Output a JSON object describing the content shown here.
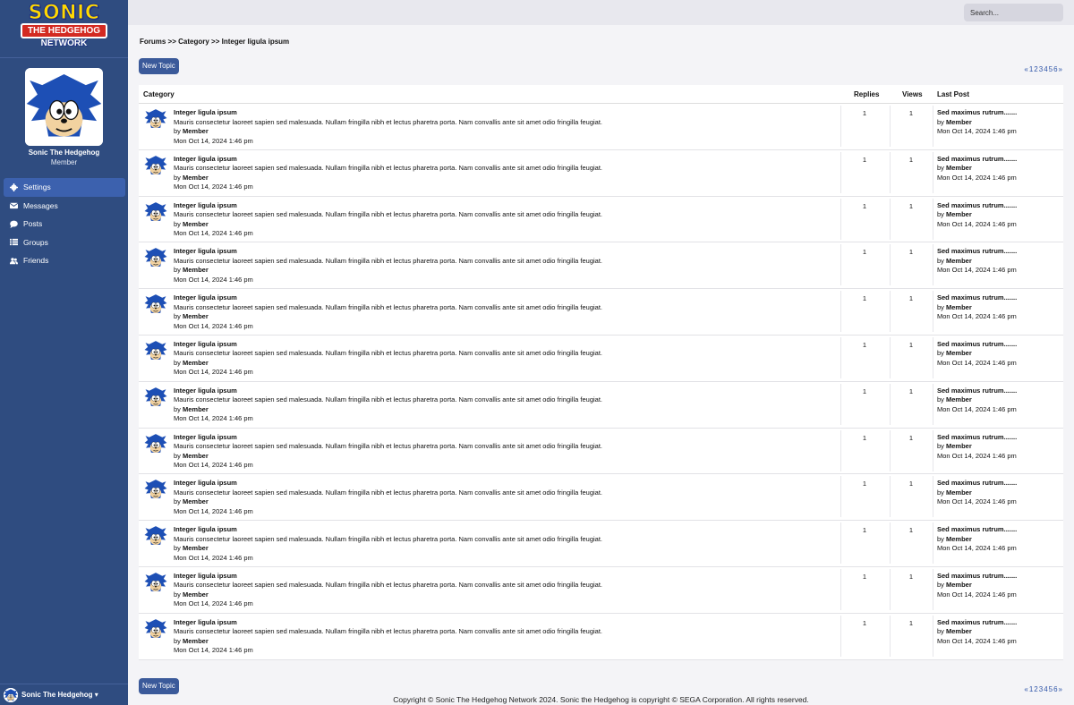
{
  "brand": {
    "line1": "SONIC",
    "line2": "THE HEDGEHOG",
    "line3": "NETWORK"
  },
  "profile": {
    "name": "Sonic The Hedgehog",
    "role": "Member"
  },
  "nav": [
    {
      "label": "Settings",
      "icon": "gear-icon"
    },
    {
      "label": "Messages",
      "icon": "envelope-icon"
    },
    {
      "label": "Posts",
      "icon": "speech-bubble-icon"
    },
    {
      "label": "Groups",
      "icon": "list-icon"
    },
    {
      "label": "Friends",
      "icon": "users-icon"
    }
  ],
  "user_menu": {
    "label": "Sonic The Hedgehog ▾"
  },
  "search": {
    "placeholder": "Search..."
  },
  "breadcrumb": "Forums >> Category >> Integer ligula ipsum",
  "buttons": {
    "new_topic": "New Topic"
  },
  "pagination": [
    "«",
    "1",
    "2",
    "3",
    "4",
    "5",
    "6",
    "»"
  ],
  "table": {
    "headers": {
      "category": "Category",
      "replies": "Replies",
      "views": "Views",
      "last_post": "Last Post"
    },
    "rows": [
      {
        "title": "Integer ligula ipsum",
        "desc": "Mauris consectetur laoreet sapien sed malesuada. Nullam fringilla nibh et lectus pharetra porta. Nam convallis ante sit amet odio fringilla feugiat.",
        "by": "by",
        "author": "Member",
        "date": "Mon Oct 14, 2024 1:46 pm",
        "replies": "1",
        "views": "1",
        "last_title": "Sed maximus rutrum.......",
        "last_by": "by",
        "last_author": "Member",
        "last_date": "Mon Oct 14, 2024 1:46 pm"
      },
      {
        "title": "Integer ligula ipsum",
        "desc": "Mauris consectetur laoreet sapien sed malesuada. Nullam fringilla nibh et lectus pharetra porta. Nam convallis ante sit amet odio fringilla feugiat.",
        "by": "by",
        "author": "Member",
        "date": "Mon Oct 14, 2024 1:46 pm",
        "replies": "1",
        "views": "1",
        "last_title": "Sed maximus rutrum.......",
        "last_by": "by",
        "last_author": "Member",
        "last_date": "Mon Oct 14, 2024 1:46 pm"
      },
      {
        "title": "Integer ligula ipsum",
        "desc": "Mauris consectetur laoreet sapien sed malesuada. Nullam fringilla nibh et lectus pharetra porta. Nam convallis ante sit amet odio fringilla feugiat.",
        "by": "by",
        "author": "Member",
        "date": "Mon Oct 14, 2024 1:46 pm",
        "replies": "1",
        "views": "1",
        "last_title": "Sed maximus rutrum.......",
        "last_by": "by",
        "last_author": "Member",
        "last_date": "Mon Oct 14, 2024 1:46 pm"
      },
      {
        "title": "Integer ligula ipsum",
        "desc": "Mauris consectetur laoreet sapien sed malesuada. Nullam fringilla nibh et lectus pharetra porta. Nam convallis ante sit amet odio fringilla feugiat.",
        "by": "by",
        "author": "Member",
        "date": "Mon Oct 14, 2024 1:46 pm",
        "replies": "1",
        "views": "1",
        "last_title": "Sed maximus rutrum.......",
        "last_by": "by",
        "last_author": "Member",
        "last_date": "Mon Oct 14, 2024 1:46 pm"
      },
      {
        "title": "Integer ligula ipsum",
        "desc": "Mauris consectetur laoreet sapien sed malesuada. Nullam fringilla nibh et lectus pharetra porta. Nam convallis ante sit amet odio fringilla feugiat.",
        "by": "by",
        "author": "Member",
        "date": "Mon Oct 14, 2024 1:46 pm",
        "replies": "1",
        "views": "1",
        "last_title": "Sed maximus rutrum.......",
        "last_by": "by",
        "last_author": "Member",
        "last_date": "Mon Oct 14, 2024 1:46 pm"
      },
      {
        "title": "Integer ligula ipsum",
        "desc": "Mauris consectetur laoreet sapien sed malesuada. Nullam fringilla nibh et lectus pharetra porta. Nam convallis ante sit amet odio fringilla feugiat.",
        "by": "by",
        "author": "Member",
        "date": "Mon Oct 14, 2024 1:46 pm",
        "replies": "1",
        "views": "1",
        "last_title": "Sed maximus rutrum.......",
        "last_by": "by",
        "last_author": "Member",
        "last_date": "Mon Oct 14, 2024 1:46 pm"
      },
      {
        "title": "Integer ligula ipsum",
        "desc": "Mauris consectetur laoreet sapien sed malesuada. Nullam fringilla nibh et lectus pharetra porta. Nam convallis ante sit amet odio fringilla feugiat.",
        "by": "by",
        "author": "Member",
        "date": "Mon Oct 14, 2024 1:46 pm",
        "replies": "1",
        "views": "1",
        "last_title": "Sed maximus rutrum.......",
        "last_by": "by",
        "last_author": "Member",
        "last_date": "Mon Oct 14, 2024 1:46 pm"
      },
      {
        "title": "Integer ligula ipsum",
        "desc": "Mauris consectetur laoreet sapien sed malesuada. Nullam fringilla nibh et lectus pharetra porta. Nam convallis ante sit amet odio fringilla feugiat.",
        "by": "by",
        "author": "Member",
        "date": "Mon Oct 14, 2024 1:46 pm",
        "replies": "1",
        "views": "1",
        "last_title": "Sed maximus rutrum.......",
        "last_by": "by",
        "last_author": "Member",
        "last_date": "Mon Oct 14, 2024 1:46 pm"
      },
      {
        "title": "Integer ligula ipsum",
        "desc": "Mauris consectetur laoreet sapien sed malesuada. Nullam fringilla nibh et lectus pharetra porta. Nam convallis ante sit amet odio fringilla feugiat.",
        "by": "by",
        "author": "Member",
        "date": "Mon Oct 14, 2024 1:46 pm",
        "replies": "1",
        "views": "1",
        "last_title": "Sed maximus rutrum.......",
        "last_by": "by",
        "last_author": "Member",
        "last_date": "Mon Oct 14, 2024 1:46 pm"
      },
      {
        "title": "Integer ligula ipsum",
        "desc": "Mauris consectetur laoreet sapien sed malesuada. Nullam fringilla nibh et lectus pharetra porta. Nam convallis ante sit amet odio fringilla feugiat.",
        "by": "by",
        "author": "Member",
        "date": "Mon Oct 14, 2024 1:46 pm",
        "replies": "1",
        "views": "1",
        "last_title": "Sed maximus rutrum.......",
        "last_by": "by",
        "last_author": "Member",
        "last_date": "Mon Oct 14, 2024 1:46 pm"
      },
      {
        "title": "Integer ligula ipsum",
        "desc": "Mauris consectetur laoreet sapien sed malesuada. Nullam fringilla nibh et lectus pharetra porta. Nam convallis ante sit amet odio fringilla feugiat.",
        "by": "by",
        "author": "Member",
        "date": "Mon Oct 14, 2024 1:46 pm",
        "replies": "1",
        "views": "1",
        "last_title": "Sed maximus rutrum.......",
        "last_by": "by",
        "last_author": "Member",
        "last_date": "Mon Oct 14, 2024 1:46 pm"
      },
      {
        "title": "Integer ligula ipsum",
        "desc": "Mauris consectetur laoreet sapien sed malesuada. Nullam fringilla nibh et lectus pharetra porta. Nam convallis ante sit amet odio fringilla feugiat.",
        "by": "by",
        "author": "Member",
        "date": "Mon Oct 14, 2024 1:46 pm",
        "replies": "1",
        "views": "1",
        "last_title": "Sed maximus rutrum.......",
        "last_by": "by",
        "last_author": "Member",
        "last_date": "Mon Oct 14, 2024 1:46 pm"
      }
    ]
  },
  "footer": "Copyright © Sonic The Hedgehog Network 2024. Sonic the Hedgehog is copyright © SEGA Corporation. All rights reserved.",
  "colors": {
    "sidebar": "#2f4c80",
    "accent": "#3b5a9a",
    "active_nav": "#3c61ae",
    "link": "#2f55a8"
  }
}
